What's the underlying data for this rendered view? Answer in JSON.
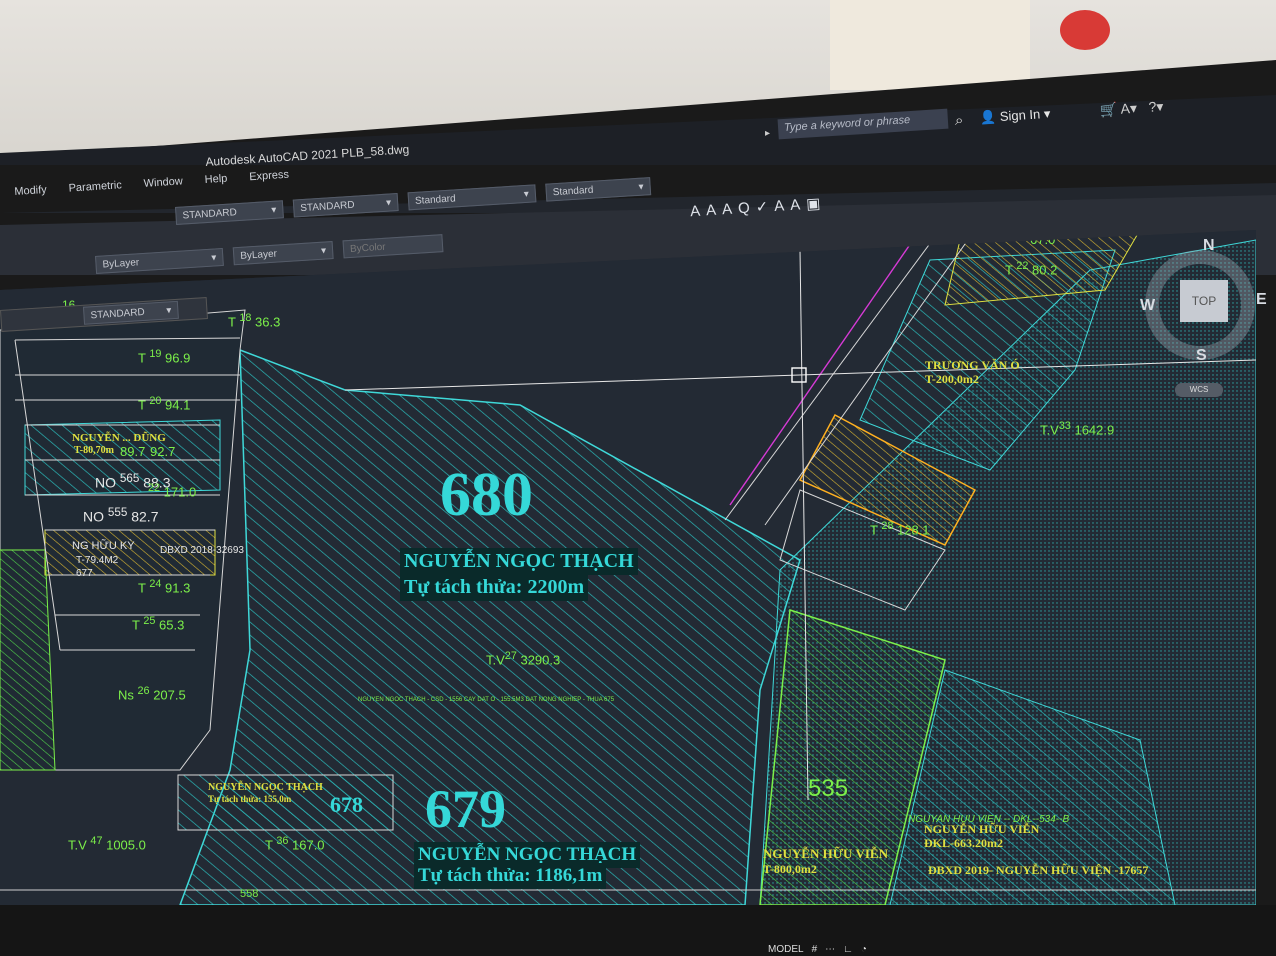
{
  "window": {
    "title": "Autodesk AutoCAD 2021    PLB_58.dwg"
  },
  "search": {
    "placeholder": "Type a keyword or phrase"
  },
  "account": {
    "signin": "Sign In"
  },
  "menu": [
    "Modify",
    "Parametric",
    "Window",
    "Help",
    "Express"
  ],
  "toolbar": {
    "textstyle": "STANDARD",
    "dimstyle": "STANDARD",
    "tablestyle": "Standard",
    "mleaderstyle": "Standard",
    "linetype": "ByLayer",
    "lineweight": "ByLayer",
    "plotstyle": "ByColor",
    "float_textstyle": "STANDARD"
  },
  "viewcube": {
    "n": "N",
    "s": "S",
    "e": "E",
    "w": "W",
    "face": "TOP",
    "ucs": "WCS"
  },
  "parcels": {
    "p680": {
      "number": "680",
      "owner": "NGUYỄN NGỌC THẠCH",
      "note": "Tự tách thửa: 2200m"
    },
    "p679": {
      "number": "679",
      "owner": "NGUYỄN NGỌC THẠCH",
      "note": "Tự tách thửa: 1186,1m"
    },
    "p678": {
      "number": "678",
      "owner": "NGUYỄN NGỌC THẠCH",
      "note": "Tự tách thửa: 155,0m"
    },
    "p535": {
      "number": "535",
      "owner": "NGUYỄN HỮU VIỄN",
      "area": "T-800,0m2"
    }
  },
  "labels": {
    "tv27": "T.V",
    "tv27n": "27",
    "tv27a": "3290.3",
    "tv33": "T.V",
    "tv33n": "33",
    "tv33a": "1642.9",
    "t28n": "28",
    "t28a": "128.1",
    "t22n": "22",
    "t22a": "80.2",
    "t670": "67.0",
    "truong": "TRƯƠNG VĂN Ó",
    "truong_area": "T-200,0m2",
    "t18n": "18",
    "t18a": "36.3",
    "t19n": "19",
    "t19a": "96.9",
    "t20n": "20",
    "t20a": "94.1",
    "nguyen_dung": "NGUYỄN ... DŨNG",
    "nguyen_dung_area": "T-80,70m",
    "v897": "89.7",
    "v927": "92.7",
    "no565": "NO",
    "v565": "565",
    "v883": "88.3",
    "v22": "22",
    "v1710": "171.0",
    "no555": "NO",
    "v555": "555",
    "v827": "82.7",
    "huuky": "NG HỮU KỲ",
    "huuky_area": "T-79.4M2",
    "dbxd": "DBXD 2018-32693",
    "v677": "677",
    "t24n": "24",
    "t24a": "91.3",
    "t25n": "25",
    "t25a": "65.3",
    "ns26": "Ns",
    "ns26n": "26",
    "ns26a": "207.5",
    "tv47": "T.V",
    "tv47n": "47",
    "tv47a": "1005.0",
    "t36n": "36",
    "t36a": "167.0",
    "v16": "16",
    "nhv": "NGUYỄN HỮU VIỄN",
    "dkl": "ĐKL-663.20m2",
    "dkl_line": "NGUYAN HUU VIEN -- DKL--534--B",
    "dbxd2019": "ĐBXD 2019- NGUYỄN HỮU VIỆN -17657",
    "small_green": "NGUYEN NGOC THACH - CSD - 1556 CAY DAT O - 155.5M3 DAT NONG NGHIEP - THUA 675",
    "v558": "558"
  },
  "status": {
    "model": "MODEL"
  }
}
